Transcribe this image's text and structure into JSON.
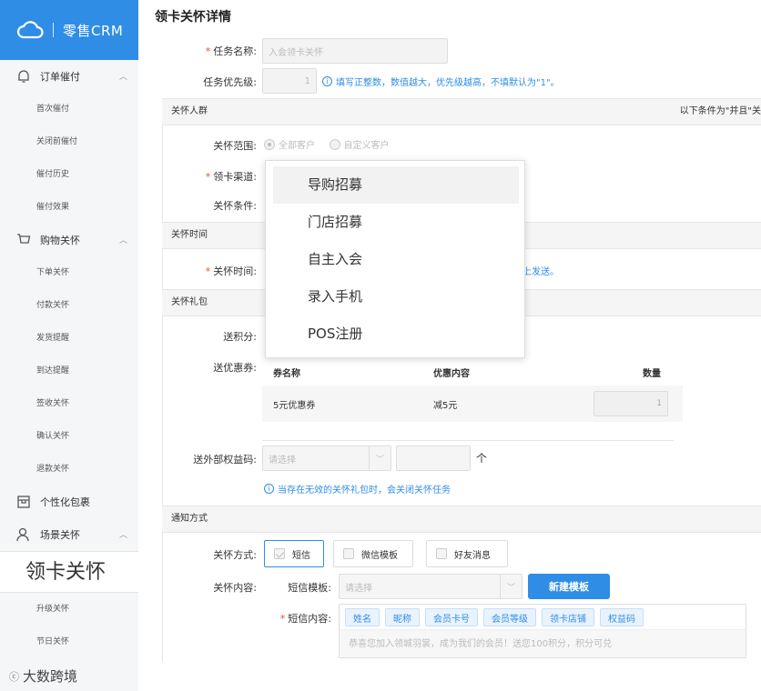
{
  "brand": {
    "name": "零售CRM",
    "accent": "#2f8de6"
  },
  "sidebar": {
    "groups": [
      {
        "label": "订单催付",
        "icon": "bell-icon",
        "items": [
          "首次催付",
          "关闭前催付",
          "催付历史",
          "催付效果"
        ]
      },
      {
        "label": "购物关怀",
        "icon": "cart-icon",
        "items": [
          "下单关怀",
          "付款关怀",
          "发货提醒",
          "到达提醒",
          "签收关怀",
          "确认关怀",
          "退款关怀"
        ]
      },
      {
        "label": "个性化包裹",
        "icon": "package-icon",
        "items": []
      },
      {
        "label": "场景关怀",
        "icon": "user-icon",
        "items": [
          "领卡关怀",
          "升级关怀",
          "节日关怀"
        ]
      }
    ],
    "active_item": "领卡关怀"
  },
  "watermark": "大数跨境",
  "page": {
    "title": "领卡关怀详情",
    "task_name_label": "任务名称:",
    "task_name_value": "入会领卡关怀",
    "priority_label": "任务优先级:",
    "priority_value": "1",
    "priority_hint": "填写正整数，数值越大，优先级越高，不填默认为\"1\"。"
  },
  "audience": {
    "header": "关怀人群",
    "header_note": "以下条件为\"并且\"关",
    "scope_label": "关怀范围:",
    "scope_options": [
      "全部客户",
      "自定义客户"
    ],
    "channel_label": "领卡渠道:",
    "condition_label": "关怀条件:"
  },
  "channel_dropdown": {
    "options": [
      "导购招募",
      "门店招募",
      "自主入会",
      "录入手机",
      "POS注册"
    ],
    "hovered": "导购招募"
  },
  "timing": {
    "header": "关怀时间",
    "label": "关怀时间:",
    "text_fragment": "上发送。"
  },
  "gift": {
    "header": "关怀礼包",
    "points_label": "送积分:",
    "coupon_label": "送优惠券:",
    "coupon_columns": [
      "券名称",
      "优惠内容",
      "数量"
    ],
    "coupons": [
      {
        "name": "5元优惠券",
        "content": "减5元",
        "qty": "1"
      }
    ],
    "equity_label": "送外部权益码:",
    "equity_placeholder": "请选择",
    "equity_unit": "个",
    "invalid_hint": "当存在无效的关怀礼包时，会关闭关怀任务"
  },
  "notify": {
    "header": "通知方式",
    "method_label": "关怀方式:",
    "methods": [
      {
        "label": "短信",
        "checked": true
      },
      {
        "label": "微信模板",
        "checked": false
      },
      {
        "label": "好友消息",
        "checked": false
      }
    ],
    "content_label": "关怀内容:",
    "sms_template_label": "短信模板:",
    "sms_template_placeholder": "请选择",
    "new_template_button": "新建模板",
    "sms_content_label": "短信内容:",
    "variable_tags": [
      "姓名",
      "昵称",
      "会员卡号",
      "会员等级",
      "领卡店铺",
      "权益码"
    ],
    "sms_text": "恭喜您加入领城羽裳，成为我们的会员！送您100积分，积分可兑"
  }
}
